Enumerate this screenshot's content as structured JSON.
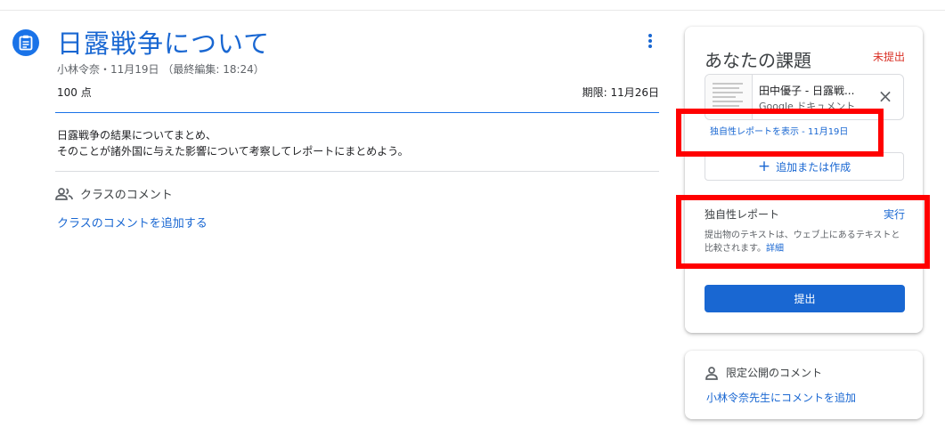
{
  "assignment": {
    "title": "日露戦争について",
    "meta": "小林令奈・11月19日 （最終編集: 18:24）",
    "points": "100 点",
    "due": "期限: 11月26日",
    "description_line1": "日露戦争の結果についてまとめ、",
    "description_line2": "そのことが諸外国に与えた影響について考察してレポートにまとめよう。"
  },
  "class_comments": {
    "heading": "クラスのコメント",
    "add_link": "クラスのコメントを追加する"
  },
  "work_card": {
    "title": "あなたの課題",
    "status": "未提出",
    "status_color": "#d93025",
    "attachment": {
      "title": "田中優子 - 日露戦...",
      "subtitle": "Google ドキュメント",
      "close_icon": "close-icon"
    },
    "originality_link": "独自性レポートを表示 - 11月19日",
    "add_create_label": "追加または作成",
    "originality": {
      "heading": "独自性レポート",
      "run_label": "実行",
      "description": "提出物のテキストは、ウェブ上にあるテキストと比較されます。",
      "more_label": "詳細"
    },
    "submit_label": "提出"
  },
  "private_comments": {
    "heading": "限定公開のコメント",
    "add_link": "小林令奈先生にコメントを追加"
  },
  "colors": {
    "accent": "#1967d2",
    "highlight": "#ff0000"
  }
}
